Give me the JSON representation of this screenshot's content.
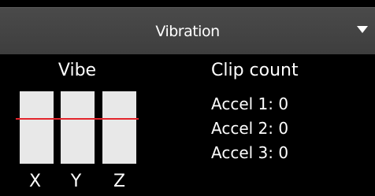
{
  "header": {
    "title": "Vibration",
    "menu_icon": "caret-down-icon"
  },
  "vibe": {
    "title": "Vibe",
    "axes": [
      "X",
      "Y",
      "Z"
    ],
    "bar_color": "#e8e8e8",
    "threshold_color": "#e3242b"
  },
  "clip": {
    "title": "Clip count",
    "rows": [
      "Accel 1: 0",
      "Accel 2: 0",
      "Accel 3: 0"
    ]
  }
}
